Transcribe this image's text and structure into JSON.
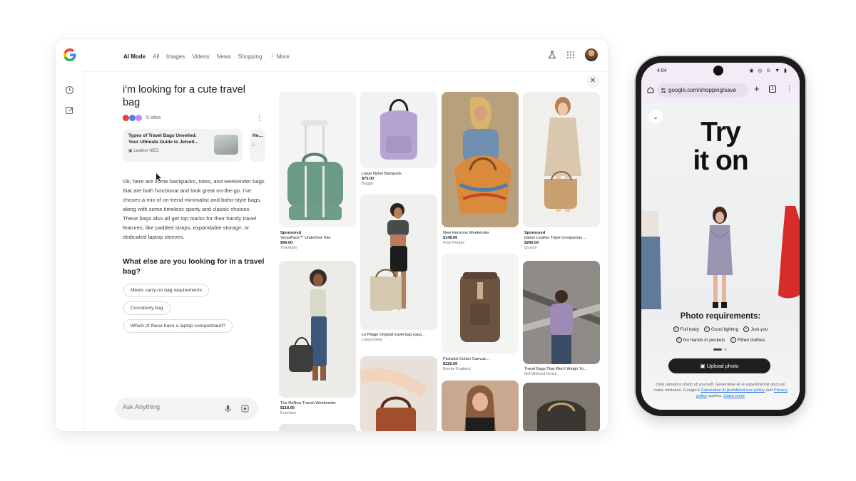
{
  "desktop": {
    "nav_tabs": [
      {
        "label": "AI Mode",
        "active": true
      },
      {
        "label": "All"
      },
      {
        "label": "Images"
      },
      {
        "label": "Videos"
      },
      {
        "label": "News"
      },
      {
        "label": "Shopping"
      },
      {
        "label": "⋮ More"
      }
    ],
    "query": "i'm looking for a cute travel bag",
    "sites_count": "5 sites",
    "sources": [
      {
        "title": "Types of Travel Bags Unveiled: Your Ultimate Guide to Jetsett...",
        "site": "Leather NEO"
      },
      {
        "title": "Ho…",
        "site": "I…"
      }
    ],
    "answer": "Ok, here are some backpacks, totes, and weekender bags that are both functional and look great on-the-go. I've chosen a mix of on-trend minimalist and boho-style bags, along with some timeless sporty and classic choices. These bags also all get top marks for their handy travel features, like padded straps, expandable storage, or dedicated laptop sleeves.",
    "followup_question": "What else are you looking for in a travel bag?",
    "chips": [
      "Meets carry-on bag requirements",
      "Crossbody bag",
      "Which of these have a laptop compartment?"
    ],
    "ask_placeholder": "Ask Anything",
    "products": [
      {
        "sponsored": "Sponsored",
        "name": "VersaPack™ Underfoot Tote",
        "price": "$99.00",
        "store": "Travelpro"
      },
      {
        "name": "Large Nylon Backpack",
        "price": "$75.00",
        "store": "Baggu"
      },
      {
        "name": "New Horizons Weekender",
        "price": "$148.00",
        "store": "Free People"
      },
      {
        "sponsored": "Sponsored",
        "name": "Italian Leather Triple Compartme…",
        "price": "$295.00",
        "store": "Quince"
      },
      {
        "name": "Le Pliage Original travel bag expa…",
        "price": "",
        "store": "Longchamp"
      },
      {
        "name": "Pickwick Cotton Canvas…",
        "price": "$220.00",
        "store": "Bronte England"
      },
      {
        "name": "Travel Bags That Won't Weigh Yo…",
        "price": "",
        "store": "Not Without Grace"
      },
      {
        "name": "The ReNew Transit Weekender",
        "price": "$118.00",
        "store": "Everlane"
      }
    ],
    "colors": {
      "google_blue": "#4285f4",
      "google_red": "#ea4335",
      "google_yellow": "#fbbc05",
      "google_green": "#34a853"
    }
  },
  "phone": {
    "time": "4:04",
    "status_icons": "◉ ◎ ⊙ ▼ ▮",
    "url": "google.com/shopping/save",
    "title_line1": "Try",
    "title_line2": "it on",
    "requirements_title": "Photo requirements:",
    "requirements": [
      "Full body",
      "Good lighting",
      "Just you",
      "No hands in pockets",
      "Fitted clothes"
    ],
    "upload_label": "Upload photo",
    "disclaimer": {
      "text1": "Only upload a photo of yourself. Generative AI is experimental and can make mistakes. Google's",
      "link1": "Generative AI prohibited use policy",
      "text2": "and",
      "link2": "Privacy policy",
      "text3": "applies.",
      "link3": "Learn more"
    }
  }
}
